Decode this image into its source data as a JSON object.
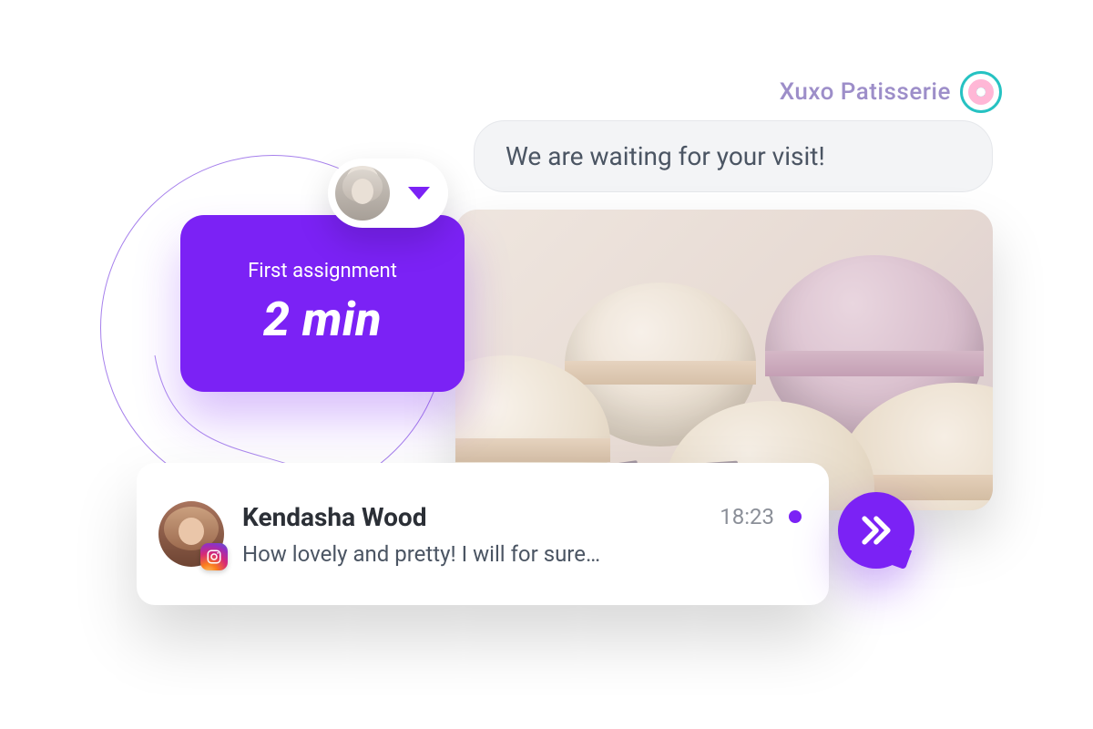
{
  "brand": {
    "name": "Xuxo Patisserie"
  },
  "message": {
    "text": "We are waiting for your visit!"
  },
  "assignment": {
    "label": "First assignment",
    "time": "2 min"
  },
  "comment": {
    "name": "Kendasha Wood",
    "time": "18:23",
    "text": "How lovely and pretty! I will for sure…",
    "source": "instagram"
  },
  "icons": {
    "dropdown": "chevron-down",
    "reply": "double-chevron-right",
    "donut": "donut-logo"
  },
  "colors": {
    "accent": "#7b22f5",
    "brand_ring": "#26c2c2",
    "brand_text": "#9d8ec9"
  }
}
